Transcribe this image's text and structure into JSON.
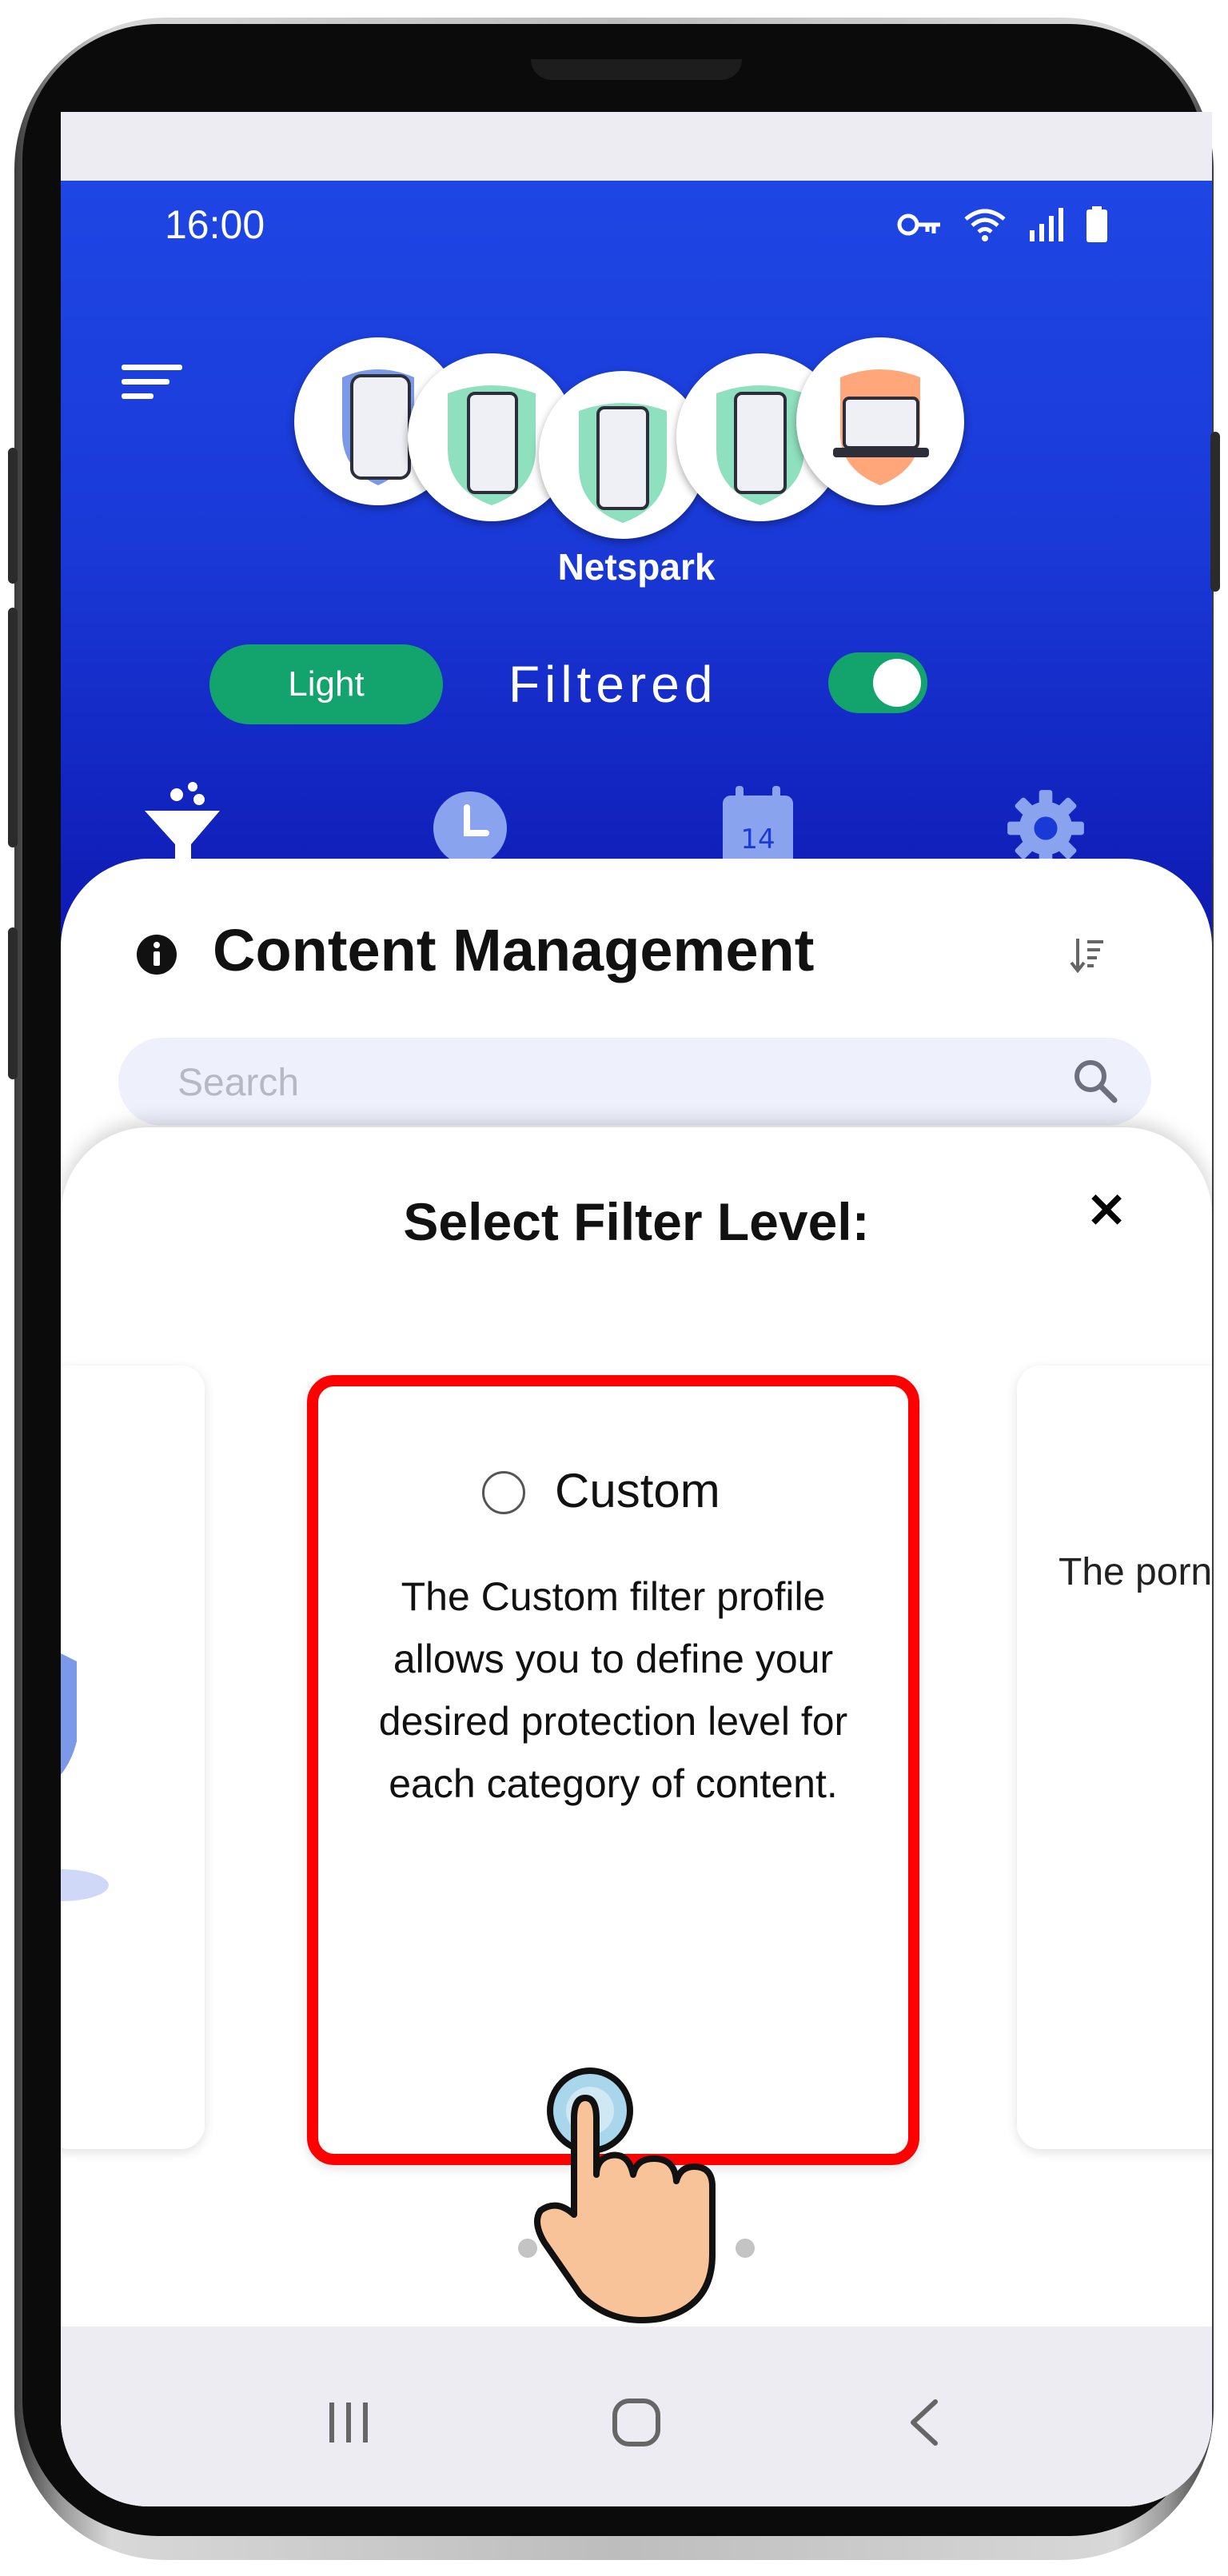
{
  "status_bar": {
    "time": "16:00",
    "icons": [
      "vpn-key-icon",
      "wifi-icon",
      "signal-icon",
      "battery-icon"
    ]
  },
  "header": {
    "menu_icon": "hamburger-menu-icon",
    "brand": "Netspark",
    "level_badge": "Light",
    "mode_label": "Filtered",
    "filter_enabled": true,
    "devices": [
      "phone-blue",
      "phone-green",
      "phone-green",
      "phone-green",
      "laptop-orange"
    ],
    "tabs": [
      {
        "name": "filter",
        "icon": "filter-icon",
        "active": true
      },
      {
        "name": "history",
        "icon": "clock-icon",
        "active": false
      },
      {
        "name": "schedule",
        "icon": "calendar-icon",
        "active": false,
        "day": "14"
      },
      {
        "name": "settings",
        "icon": "gear-icon",
        "active": false
      }
    ]
  },
  "content": {
    "title": "Content Management",
    "search_placeholder": "Search"
  },
  "sheet": {
    "title": "Select Filter Level:",
    "close": "×",
    "selected_option": {
      "name": "Custom",
      "description": "The Custom filter profile allows you to define your desired protection level for each category of content."
    },
    "next_option_partial": "The porn full r",
    "pagination": {
      "count": 5,
      "active_index": 1
    }
  },
  "colors": {
    "header_blue": "#1a3ad8",
    "accent_green": "#12a46c",
    "highlight_red": "#ff0000"
  }
}
